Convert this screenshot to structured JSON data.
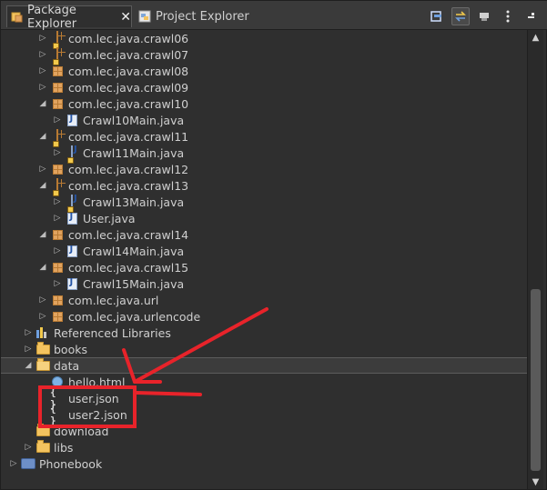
{
  "tabs": [
    {
      "label": "Package Explorer",
      "active": true
    },
    {
      "label": "Project Explorer",
      "active": false
    }
  ],
  "tab_close_glyph": "✕",
  "toolbar": {
    "icons": [
      "collapse-all-icon",
      "link-with-editor-icon",
      "focus-icon",
      "view-menu-icon",
      "minimize-icon"
    ]
  },
  "tree": {
    "rows": [
      {
        "label": "com.lec.java.crawl06",
        "indent": 2,
        "twisty": "▷",
        "icon": "package-warning"
      },
      {
        "label": "com.lec.java.crawl07",
        "indent": 2,
        "twisty": "▷",
        "icon": "package-warning"
      },
      {
        "label": "com.lec.java.crawl08",
        "indent": 2,
        "twisty": "▷",
        "icon": "package"
      },
      {
        "label": "com.lec.java.crawl09",
        "indent": 2,
        "twisty": "▷",
        "icon": "package"
      },
      {
        "label": "com.lec.java.crawl10",
        "indent": 2,
        "twisty": "◢",
        "icon": "package"
      },
      {
        "label": "Crawl10Main.java",
        "indent": 3,
        "twisty": "▷",
        "icon": "java"
      },
      {
        "label": "com.lec.java.crawl11",
        "indent": 2,
        "twisty": "◢",
        "icon": "package-warning"
      },
      {
        "label": "Crawl11Main.java",
        "indent": 3,
        "twisty": "▷",
        "icon": "java-warning"
      },
      {
        "label": "com.lec.java.crawl12",
        "indent": 2,
        "twisty": "▷",
        "icon": "package"
      },
      {
        "label": "com.lec.java.crawl13",
        "indent": 2,
        "twisty": "◢",
        "icon": "package-warning"
      },
      {
        "label": "Crawl13Main.java",
        "indent": 3,
        "twisty": "▷",
        "icon": "java-warning"
      },
      {
        "label": "User.java",
        "indent": 3,
        "twisty": "▷",
        "icon": "java"
      },
      {
        "label": "com.lec.java.crawl14",
        "indent": 2,
        "twisty": "◢",
        "icon": "package"
      },
      {
        "label": "Crawl14Main.java",
        "indent": 3,
        "twisty": "▷",
        "icon": "java"
      },
      {
        "label": "com.lec.java.crawl15",
        "indent": 2,
        "twisty": "◢",
        "icon": "package"
      },
      {
        "label": "Crawl15Main.java",
        "indent": 3,
        "twisty": "▷",
        "icon": "java"
      },
      {
        "label": "com.lec.java.url",
        "indent": 2,
        "twisty": "▷",
        "icon": "package"
      },
      {
        "label": "com.lec.java.urlencode",
        "indent": 2,
        "twisty": "▷",
        "icon": "package"
      },
      {
        "label": "Referenced Libraries",
        "indent": 1,
        "twisty": "▷",
        "icon": "library"
      },
      {
        "label": "books",
        "indent": 1,
        "twisty": "▷",
        "icon": "folder"
      },
      {
        "label": "data",
        "indent": 1,
        "twisty": "◢",
        "icon": "folder-open",
        "selected": true
      },
      {
        "label": "hello.html",
        "indent": 2,
        "twisty": "",
        "icon": "html"
      },
      {
        "label": "user.json",
        "indent": 2,
        "twisty": "",
        "icon": "json"
      },
      {
        "label": "user2.json",
        "indent": 2,
        "twisty": "",
        "icon": "json"
      },
      {
        "label": "download",
        "indent": 1,
        "twisty": "",
        "icon": "folder"
      },
      {
        "label": "libs",
        "indent": 1,
        "twisty": "▷",
        "icon": "folder"
      },
      {
        "label": "Phonebook",
        "indent": 0,
        "twisty": "▷",
        "icon": "project"
      }
    ]
  },
  "colors": {
    "annotation": "#e8232a",
    "background": "#2f2f2f"
  }
}
